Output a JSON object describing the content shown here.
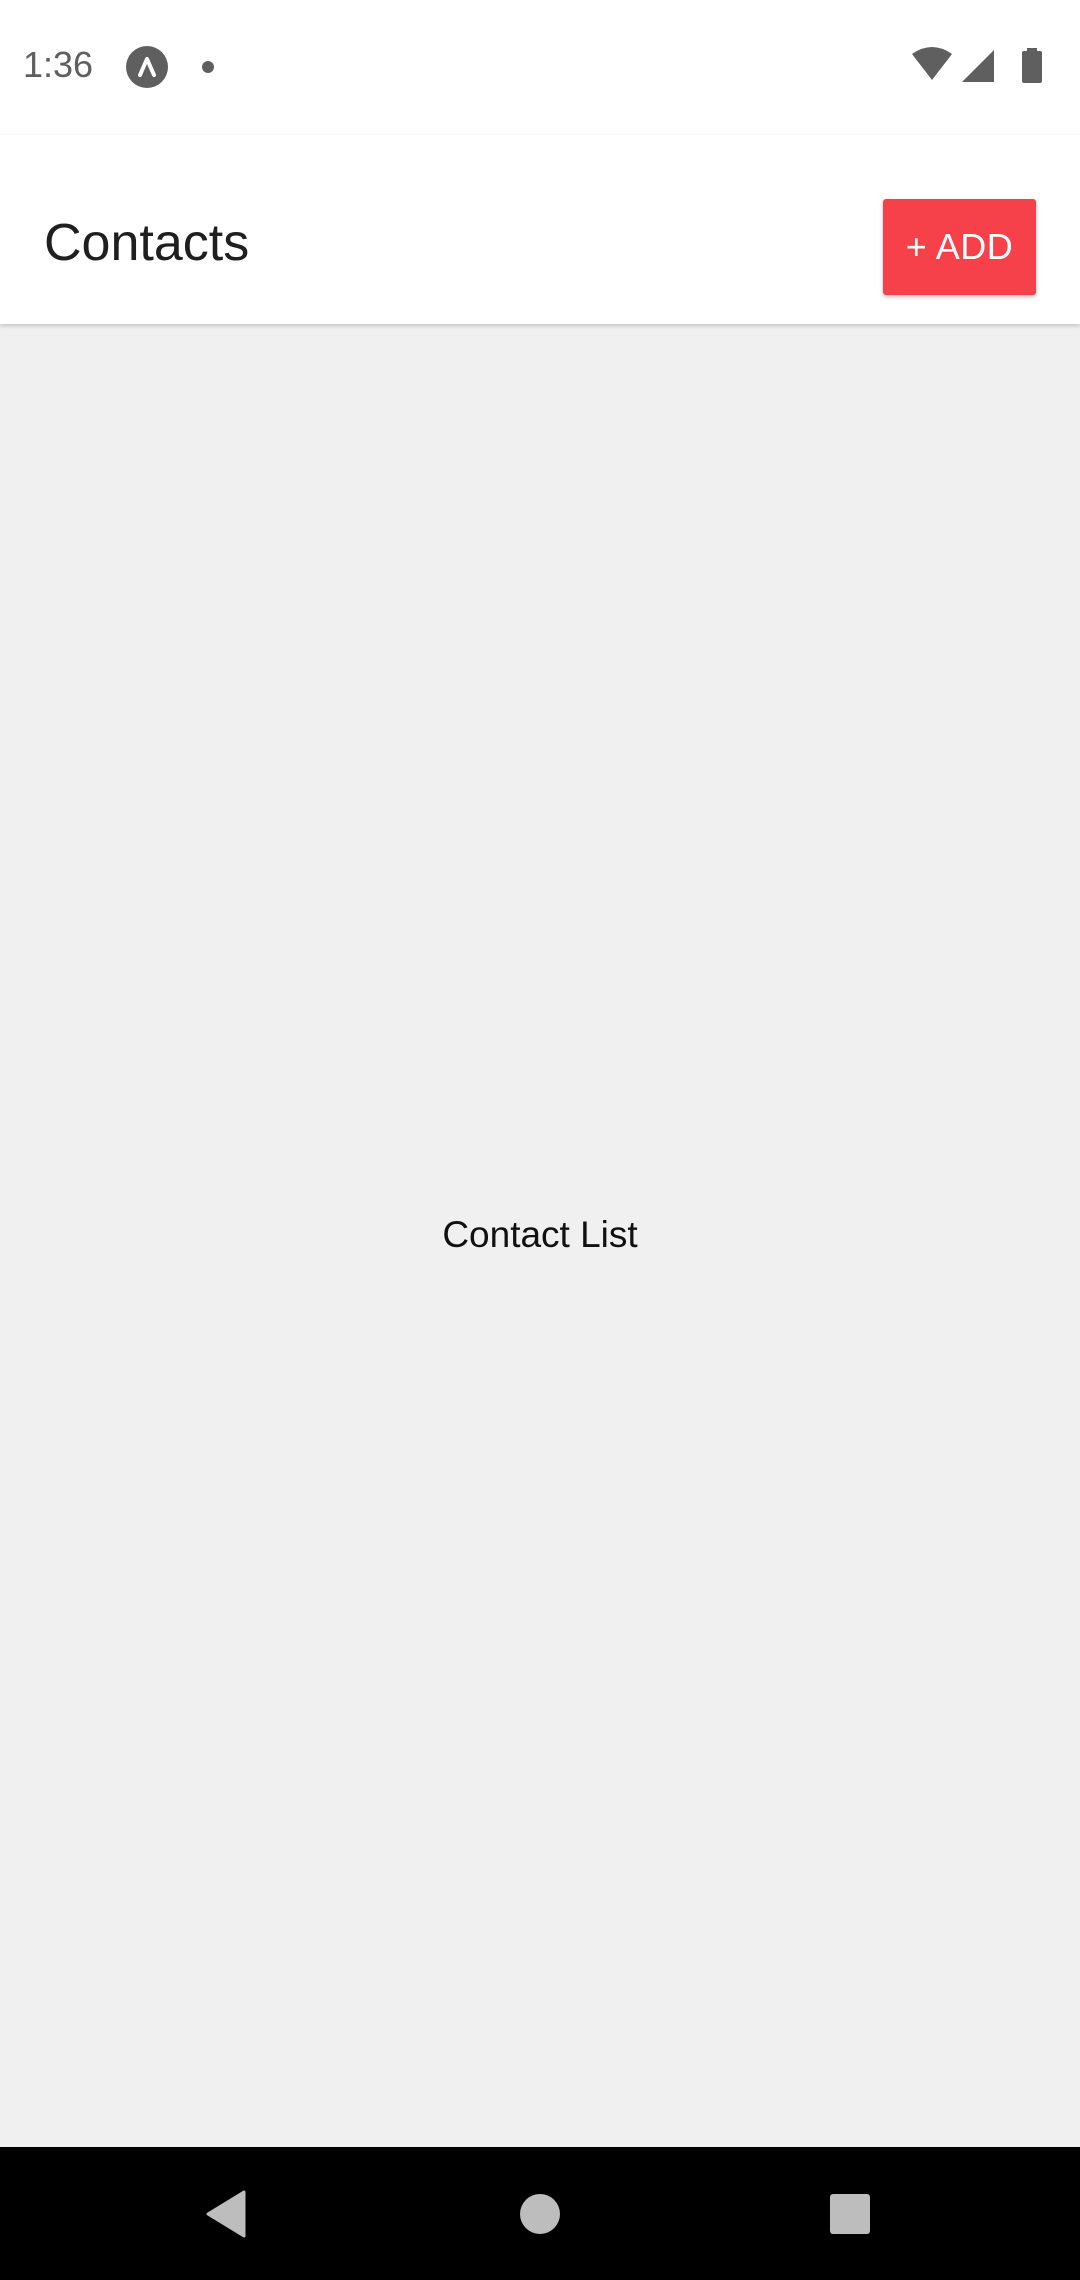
{
  "status_bar": {
    "time": "1:36",
    "app_icon": "react-native-icon",
    "notification_dot": "dot-icon",
    "wifi_icon": "wifi-icon",
    "signal_icon": "cell-signal-icon",
    "battery_icon": "battery-icon"
  },
  "app_bar": {
    "title": "Contacts",
    "add_button_label": "+ ADD"
  },
  "main": {
    "placeholder_text": "Contact List"
  },
  "nav_bar": {
    "back_icon": "back-triangle-icon",
    "home_icon": "home-circle-icon",
    "recents_icon": "recents-square-icon"
  },
  "colors": {
    "accent": "#f6414a",
    "app_bar_bg": "#ffffff",
    "content_bg": "#f0f0f0",
    "nav_bar_bg": "#000000"
  }
}
